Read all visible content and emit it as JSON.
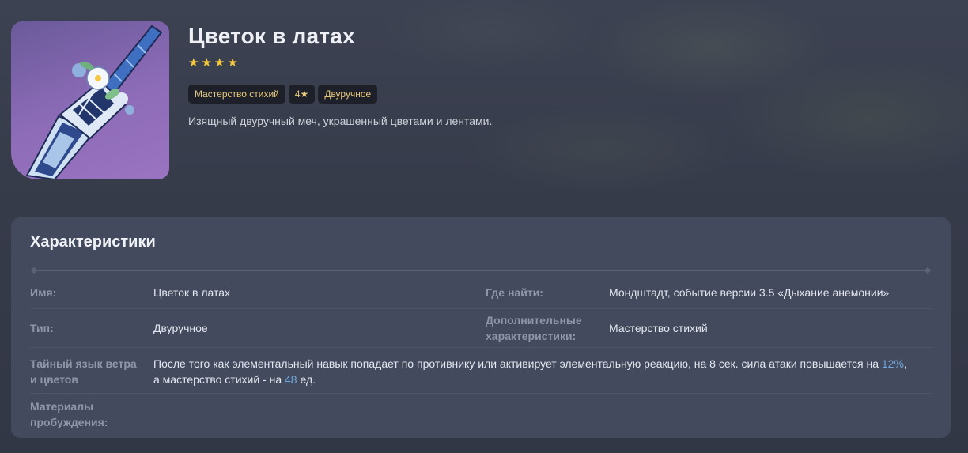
{
  "weapon": {
    "title": "Цветок в латах",
    "stars": [
      "★",
      "★",
      "★",
      "★"
    ],
    "tags": [
      "Мастерство стихий",
      "4★",
      "Двуручное"
    ],
    "description": "Изящный двуручный меч, украшенный цветами и лентами.",
    "colors": {
      "star": "#f5c73c",
      "tag_text": "#e8c87a",
      "highlight": "#6fa8dc",
      "card_bg": "#8e6cb8"
    }
  },
  "specs": {
    "title": "Характеристики",
    "name_label": "Имя:",
    "name_value": "Цветок в латах",
    "where_label": "Где найти:",
    "where_value": "Мондштадт, событие версии 3.5 «Дыхание анемонии»",
    "type_label": "Тип:",
    "type_value": "Двуручное",
    "extra_label_line1": "Дополнительные",
    "extra_label_line2": "характеристики:",
    "extra_value": "Мастерство стихий",
    "passive_label_line1": "Тайный язык ветра",
    "passive_label_line2": "и цветов",
    "passive_text_1": "После того как элементальный навык попадает по противнику или активирует элементальную реакцию, на 8 сек. сила атаки повышается на ",
    "passive_highlight_1": "12%",
    "passive_text_2": ",",
    "passive_text_3": "а мастерство стихий - на ",
    "passive_highlight_2": "48",
    "passive_text_4": " ед.",
    "materials_label_line1": "Материалы",
    "materials_label_line2": "пробуждения:"
  }
}
